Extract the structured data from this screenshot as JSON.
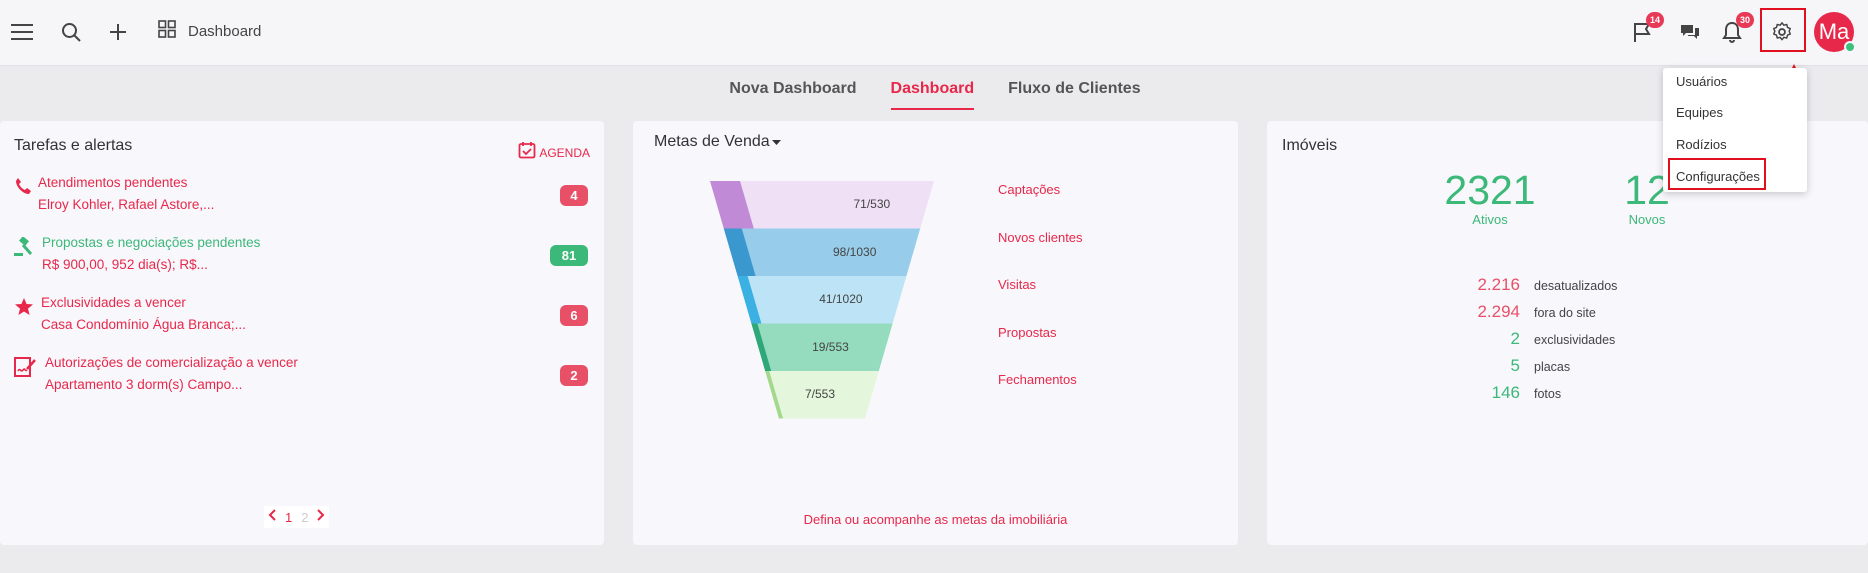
{
  "header": {
    "breadcrumb_label": "Dashboard",
    "flag_count": "14",
    "notification_count": "30",
    "avatar_initials": "Ma"
  },
  "tabs": [
    {
      "label": "Nova Dashboard"
    },
    {
      "label": "Dashboard"
    },
    {
      "label": "Fluxo de Clientes"
    }
  ],
  "tasks_card": {
    "title": "Tarefas e alertas",
    "agenda_label": "AGENDA",
    "items": [
      {
        "title": "Atendimentos pendentes",
        "subtitle": "Elroy Kohler, Rafael Astore,...",
        "count": "4",
        "icon": "phone-icon"
      },
      {
        "title": "Propostas e negociações pendentes",
        "subtitle": "R$ 900,00, 952 dia(s); R$...",
        "count": "81",
        "icon": "gavel-icon"
      },
      {
        "title": "Exclusividades a vencer",
        "subtitle": "Casa Condomínio Água Branca;...",
        "count": "6",
        "icon": "star-icon"
      },
      {
        "title": "Autorizações de comercialização a vencer",
        "subtitle": "Apartamento 3 dorm(s) Campo...",
        "count": "2",
        "icon": "signature-icon"
      }
    ],
    "pagination": {
      "current": "1",
      "next": "2"
    }
  },
  "sales_card": {
    "title": "Metas de Venda",
    "footer_link": "Defina ou acompanhe as metas da imobiliária",
    "stages": [
      {
        "label": "Captações",
        "value": "71/530",
        "color": "#efe0f5",
        "accent": "#c08ad6"
      },
      {
        "label": "Novos clientes",
        "value": "98/1030",
        "color": "#97cdea",
        "accent": "#3a98cf"
      },
      {
        "label": "Visitas",
        "value": "41/1020",
        "color": "#bde4f6",
        "accent": "#3ab0e3"
      },
      {
        "label": "Propostas",
        "value": "19/553",
        "color": "#95dcbf",
        "accent": "#2ea878"
      },
      {
        "label": "Fechamentos",
        "value": "7/553",
        "color": "#e4f6dc",
        "accent": "#a3d98d"
      }
    ]
  },
  "properties_card": {
    "title": "Imóveis",
    "active_value": "2321",
    "active_label": "Ativos",
    "new_value": "12",
    "new_label": "Novos",
    "stats": [
      {
        "value": "2.216",
        "label": "desatualizados",
        "color": "#e85068"
      },
      {
        "value": "2.294",
        "label": "fora do site",
        "color": "#e85068"
      },
      {
        "value": "2",
        "label": "exclusividades",
        "color": "#3cb878"
      },
      {
        "value": "5",
        "label": "placas",
        "color": "#3cb878"
      },
      {
        "value": "146",
        "label": "fotos",
        "color": "#3cb878"
      }
    ]
  },
  "settings_menu": {
    "items": [
      {
        "label": "Usuários"
      },
      {
        "label": "Equipes"
      },
      {
        "label": "Rodízios"
      },
      {
        "label": "Configurações"
      }
    ]
  },
  "colors": {
    "accent": "#e8284a",
    "green": "#3cb878",
    "highlight": "#e01020"
  }
}
